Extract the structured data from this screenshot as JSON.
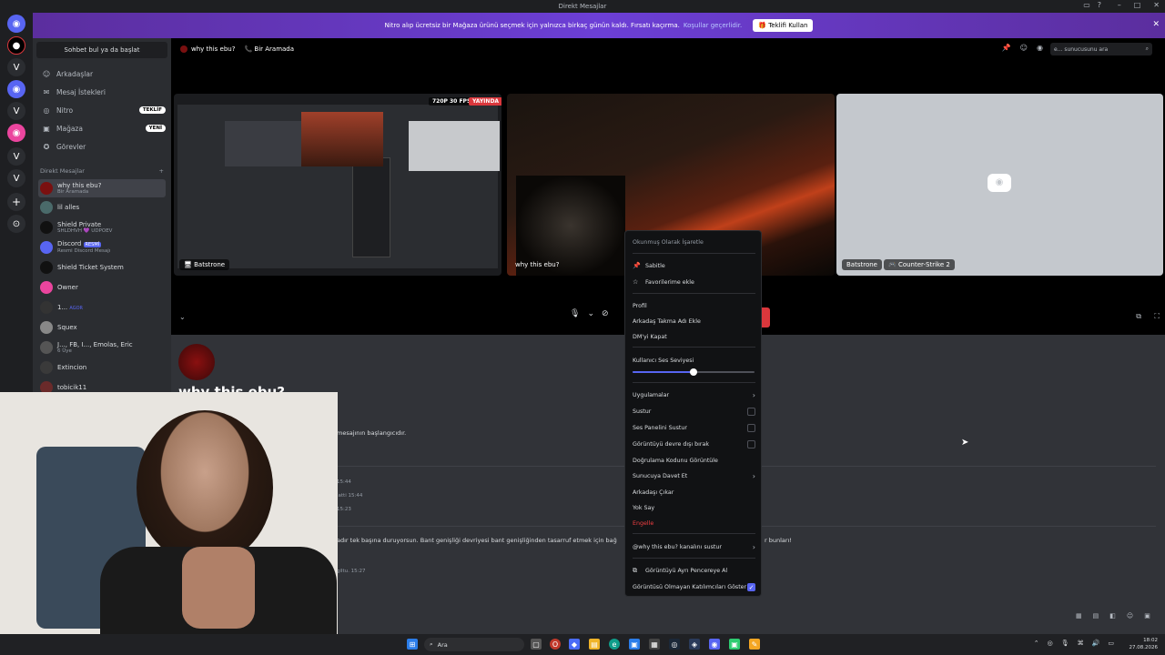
{
  "window": {
    "title": "Direkt Mesajlar"
  },
  "banner": {
    "text": "Nitro alıp ücretsiz bir Mağaza ürünü seçmek için yalnızca birkaç günün kaldı. Fırsatı kaçırma.",
    "link": "Koşullar geçerlidir.",
    "button": "Teklifi Kullan"
  },
  "sidebar": {
    "find": "Sohbet bul ya da başlat",
    "nav": [
      {
        "label": "Arkadaşlar",
        "icon": "friends-icon"
      },
      {
        "label": "Mesaj İstekleri",
        "icon": "mail-icon"
      },
      {
        "label": "Nitro",
        "icon": "nitro-icon",
        "badge": "TEKLİF"
      },
      {
        "label": "Mağaza",
        "icon": "shop-icon",
        "badge": "YENİ"
      },
      {
        "label": "Görevler",
        "icon": "quests-icon"
      }
    ],
    "dm_header": "Direkt Mesajlar",
    "dms": [
      {
        "name": "why this ebu?",
        "sub": "Bir Aramada"
      },
      {
        "name": "lil alles",
        "sub": ""
      },
      {
        "name": "Shield Private",
        "sub": "SHLDHVH 💜 UDPOEV"
      },
      {
        "name": "Discord",
        "tag": "RESMİ",
        "sub": "Resmi Discord Mesajı"
      },
      {
        "name": "Shield Ticket System",
        "sub": ""
      },
      {
        "name": "Owner",
        "sub": ""
      },
      {
        "name": "1...",
        "tag": "AGOR",
        "sub": ""
      },
      {
        "name": "Squex",
        "sub": ""
      },
      {
        "name": "J..., FB, I..., Emolas, Eric",
        "sub": "6 Üye"
      },
      {
        "name": "Extincion",
        "sub": ""
      },
      {
        "name": "tobicik11",
        "sub": ""
      }
    ]
  },
  "header": {
    "channel": "why this ebu?",
    "status": "Bir Aramada",
    "search_placeholder": "e... sunucusunu ara"
  },
  "call": {
    "fps_badge": "720P 30 FPS",
    "live_badge": "YAYINDA",
    "tiles": [
      {
        "name": "Batstrone"
      },
      {
        "name": "why this ebu?"
      },
      {
        "name": "Batstrone",
        "activity": "Counter-Strike 2"
      }
    ]
  },
  "chat": {
    "title": "why this ebu?",
    "intro": "mesajının başlangıcıdır.",
    "lines": [
      "15:44",
      "latti 15:44",
      "15:23",
      "adır tek başına duruyorsun. Bant genişliği devriyesi bant genişliğinden tasarruf etmek için bağ",
      "r bunları!",
      "giltu. 15:27"
    ]
  },
  "menu": {
    "items": [
      {
        "label": "Okunmuş Olarak İşaretle",
        "kind": "header"
      },
      {
        "label": "Sabitle",
        "icon": "pin-icon"
      },
      {
        "label": "Favorilerime ekle",
        "icon": "star-icon"
      },
      {
        "label": "Profil"
      },
      {
        "label": "Arkadaş Takma Adı Ekle"
      },
      {
        "label": "DM'yi Kapat"
      },
      {
        "label": "Kullanıcı Ses Seviyesi"
      },
      {
        "label": "Uygulamalar",
        "arrow": true
      },
      {
        "label": "Sustur",
        "check": false
      },
      {
        "label": "Ses Panelini Sustur",
        "check": false
      },
      {
        "label": "Görüntüyü devre dışı bırak",
        "check": false
      },
      {
        "label": "Doğrulama Kodunu Görüntüle"
      },
      {
        "label": "Sunucuya Davet Et",
        "arrow": true
      },
      {
        "label": "Arkadaşı Çıkar"
      },
      {
        "label": "Yok Say"
      },
      {
        "label": "Engelle",
        "kind": "danger"
      },
      {
        "label": "@why this ebu? kanalını sustur",
        "arrow": true
      },
      {
        "label": "Görüntüyü Ayrı Pencereye Al",
        "icon": "popout-icon"
      },
      {
        "label": "Görüntüsü Olmayan Katılımcıları Göster",
        "check": true
      }
    ],
    "volume_fraction": 0.5
  },
  "taskbar": {
    "search": "Ara",
    "time": "18:02",
    "date": "27.08.2026"
  },
  "colors": {
    "accent": "#5865f2",
    "danger": "#da373c",
    "banner": "#6c3fd6"
  }
}
